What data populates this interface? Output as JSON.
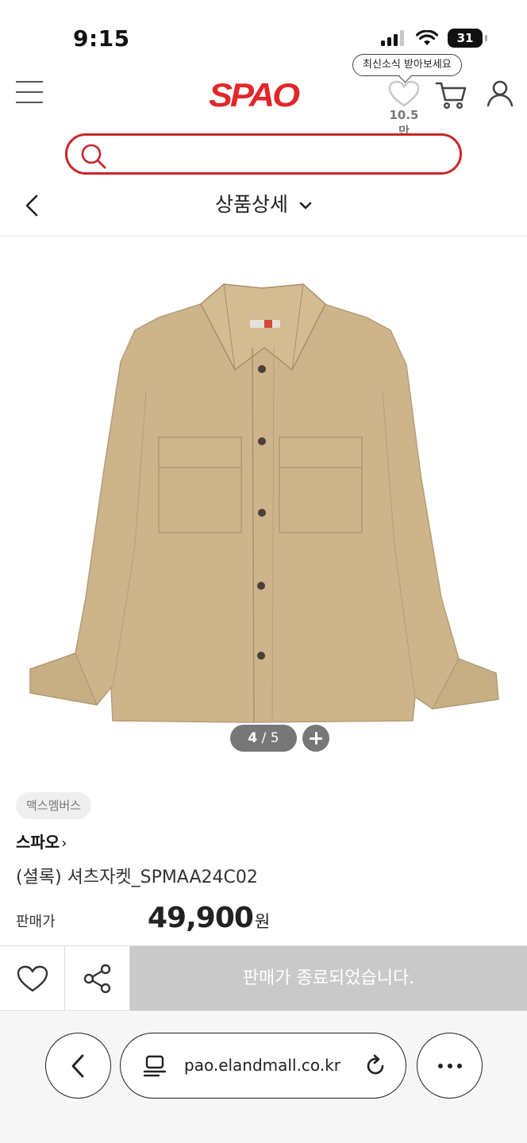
{
  "status_bar": {
    "time": "9:15",
    "battery": "31",
    "icons": [
      "signal-icon",
      "wifi-icon",
      "battery-icon"
    ]
  },
  "header": {
    "logo": "SPAO",
    "tooltip": "최신소식 받아보세요",
    "like_count": "10.5만",
    "icons": [
      "menu-icon",
      "heart-icon",
      "cart-icon",
      "user-icon"
    ],
    "brand_color": "#e3262a"
  },
  "search": {
    "placeholder": "",
    "value": ""
  },
  "subheader": {
    "title": "상품상세",
    "icons": [
      "back-icon",
      "chevron-down-icon"
    ]
  },
  "gallery": {
    "current": "4",
    "separator": "/",
    "total": "5"
  },
  "product": {
    "badge": "맥스멤버스",
    "brand": "스파오",
    "brand_arrow": "›",
    "name": "(셜록) 셔츠자켓_SPMAA24C02",
    "price_label": "판매가",
    "price": "49,900",
    "price_unit": "원"
  },
  "actions": {
    "soldout_label": "판매가 종료되었습니다.",
    "icons": [
      "heart-icon",
      "share-icon"
    ],
    "soldout_color": "#c9c9c9"
  },
  "browser": {
    "url": "pao.elandmall.co.kr",
    "icons": [
      "back-icon",
      "page-icon",
      "reload-icon",
      "more-icon"
    ]
  }
}
